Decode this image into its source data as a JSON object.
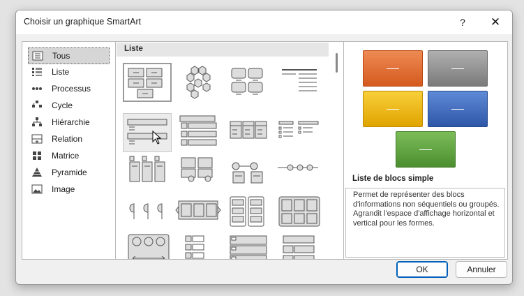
{
  "dialog": {
    "title": "Choisir un graphique SmartArt",
    "help_label": "?",
    "close_label": "✕"
  },
  "categories": [
    {
      "label": "Tous",
      "icon": "all-icon",
      "selected": true
    },
    {
      "label": "Liste",
      "icon": "list-icon"
    },
    {
      "label": "Processus",
      "icon": "process-icon"
    },
    {
      "label": "Cycle",
      "icon": "cycle-icon"
    },
    {
      "label": "Hiérarchie",
      "icon": "hierarchy-icon"
    },
    {
      "label": "Relation",
      "icon": "relation-icon"
    },
    {
      "label": "Matrice",
      "icon": "matrix-icon"
    },
    {
      "label": "Pyramide",
      "icon": "pyramid-icon"
    },
    {
      "label": "Image",
      "icon": "image-icon"
    }
  ],
  "gallery": {
    "header": "Liste",
    "selected_layout": "Liste de blocs simple"
  },
  "preview": {
    "layout_name": "Liste de blocs simple",
    "description": "Permet de représenter des blocs d'informations non séquentiels ou groupés. Agrandit l'espace d'affichage horizontal et vertical pour les formes.",
    "block_colors": [
      "#e2652a",
      "#8c8c8c",
      "#f0b400",
      "#3a68b8",
      "#5aa03c"
    ]
  },
  "buttons": {
    "ok": "OK",
    "cancel": "Annuler"
  }
}
